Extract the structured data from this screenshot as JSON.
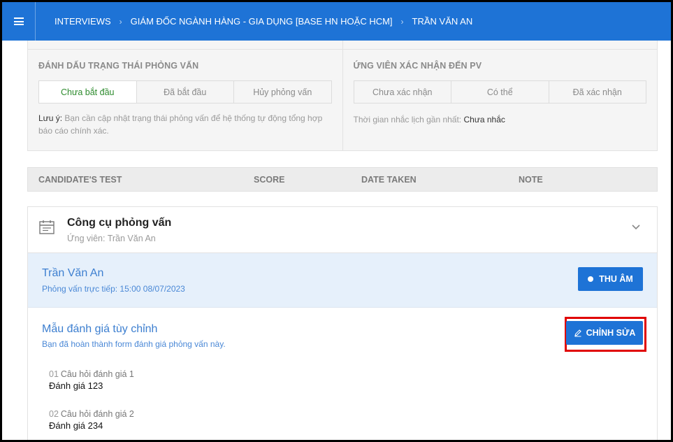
{
  "header": {
    "breadcrumbs": [
      "INTERVIEWS",
      "GIÁM ĐỐC NGÀNH HÀNG - GIA DỤNG [BASE HN HOẶC HCM]",
      "TRẦN VĂN AN"
    ]
  },
  "status": {
    "interview": {
      "title": "ĐÁNH DẤU TRẠNG THÁI PHỎNG VẤN",
      "options": [
        "Chưa bắt đầu",
        "Đã bắt đầu",
        "Hủy phỏng vấn"
      ],
      "selected": "Chưa bắt đầu",
      "note_key": "Lưu ý:",
      "note_text": "Bạn cần cập nhật trạng thái phỏng vấn để hệ thống tự động tổng hợp báo cáo chính xác."
    },
    "confirm": {
      "title": "ỨNG VIÊN XÁC NHẬN ĐẾN PV",
      "options": [
        "Chưa xác nhận",
        "Có thể",
        "Đã xác nhận"
      ],
      "reminder_label": "Thời gian nhắc lịch gần nhất:",
      "reminder_value": "Chưa nhắc"
    }
  },
  "test_table": {
    "columns": [
      "CANDIDATE'S TEST",
      "SCORE",
      "DATE TAKEN",
      "NOTE"
    ]
  },
  "tools": {
    "title": "Công cụ phỏng vấn",
    "subtitle": "Ứng viên: Trần Văn An",
    "candidate": {
      "name": "Trần Văn An",
      "info": "Phỏng vấn trực tiếp: 15:00 08/07/2023",
      "record_label": "THU ÂM"
    },
    "evaluation": {
      "title": "Mẫu đánh giá tùy chỉnh",
      "subtitle": "Bạn đã hoàn thành form đánh giá phỏng vấn này.",
      "edit_label": "CHỈNH SỬA",
      "questions": [
        {
          "num": "01",
          "label": "Câu hỏi đánh giá 1",
          "answer": "Đánh giá 123"
        },
        {
          "num": "02",
          "label": "Câu hỏi đánh giá 2",
          "answer": "Đánh giá 234"
        }
      ]
    }
  },
  "colors": {
    "primary": "#1e73d6",
    "active_status": "#2e8b2e",
    "highlight": "#e00000"
  },
  "icons": [
    "menu-icon",
    "chevron-right-icon",
    "calendar-icon",
    "chevron-down-icon",
    "record-dot-icon",
    "pencil-icon"
  ]
}
